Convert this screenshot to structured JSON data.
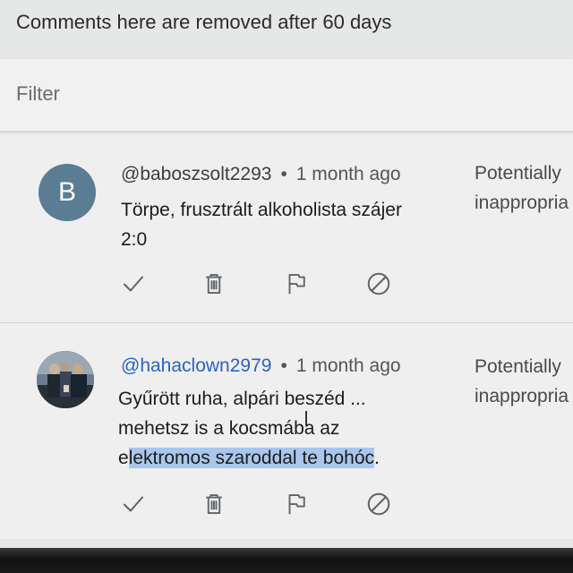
{
  "notice": {
    "text": "Comments here are removed after 60 days"
  },
  "filter": {
    "placeholder": "Filter"
  },
  "comments": [
    {
      "avatar_letter": "B",
      "avatar_color": "#5a7d94",
      "handle": "@baboszsolt2293",
      "separator": "•",
      "time": "1 month ago",
      "lines": [
        "Törpe, frusztrált alkoholista szájer",
        "2:0"
      ],
      "status": [
        "Potentially",
        "inappropria"
      ]
    },
    {
      "avatar_icon": "profile-photo",
      "handle": "@hahaclown2979",
      "separator": "•",
      "time": "1 month ago",
      "line1": "Gyűrött ruha, alpári beszéd ...",
      "line2": "mehetsz is a kocsmába az",
      "line3_pre": "e",
      "line3_highlight": "lektromos szaroddal te bohóc",
      "line3_post": ".",
      "status": [
        "Potentially",
        "inappropria"
      ]
    }
  ],
  "actions": [
    {
      "name": "approve",
      "icon": "check-icon"
    },
    {
      "name": "remove",
      "icon": "trash-icon"
    },
    {
      "name": "report",
      "icon": "flag-icon"
    },
    {
      "name": "hide-user",
      "icon": "block-icon"
    }
  ],
  "colors": {
    "handle_link": "#2a63c6",
    "highlight": "#a9c7ec",
    "avatar_b": "#5a7d94"
  }
}
